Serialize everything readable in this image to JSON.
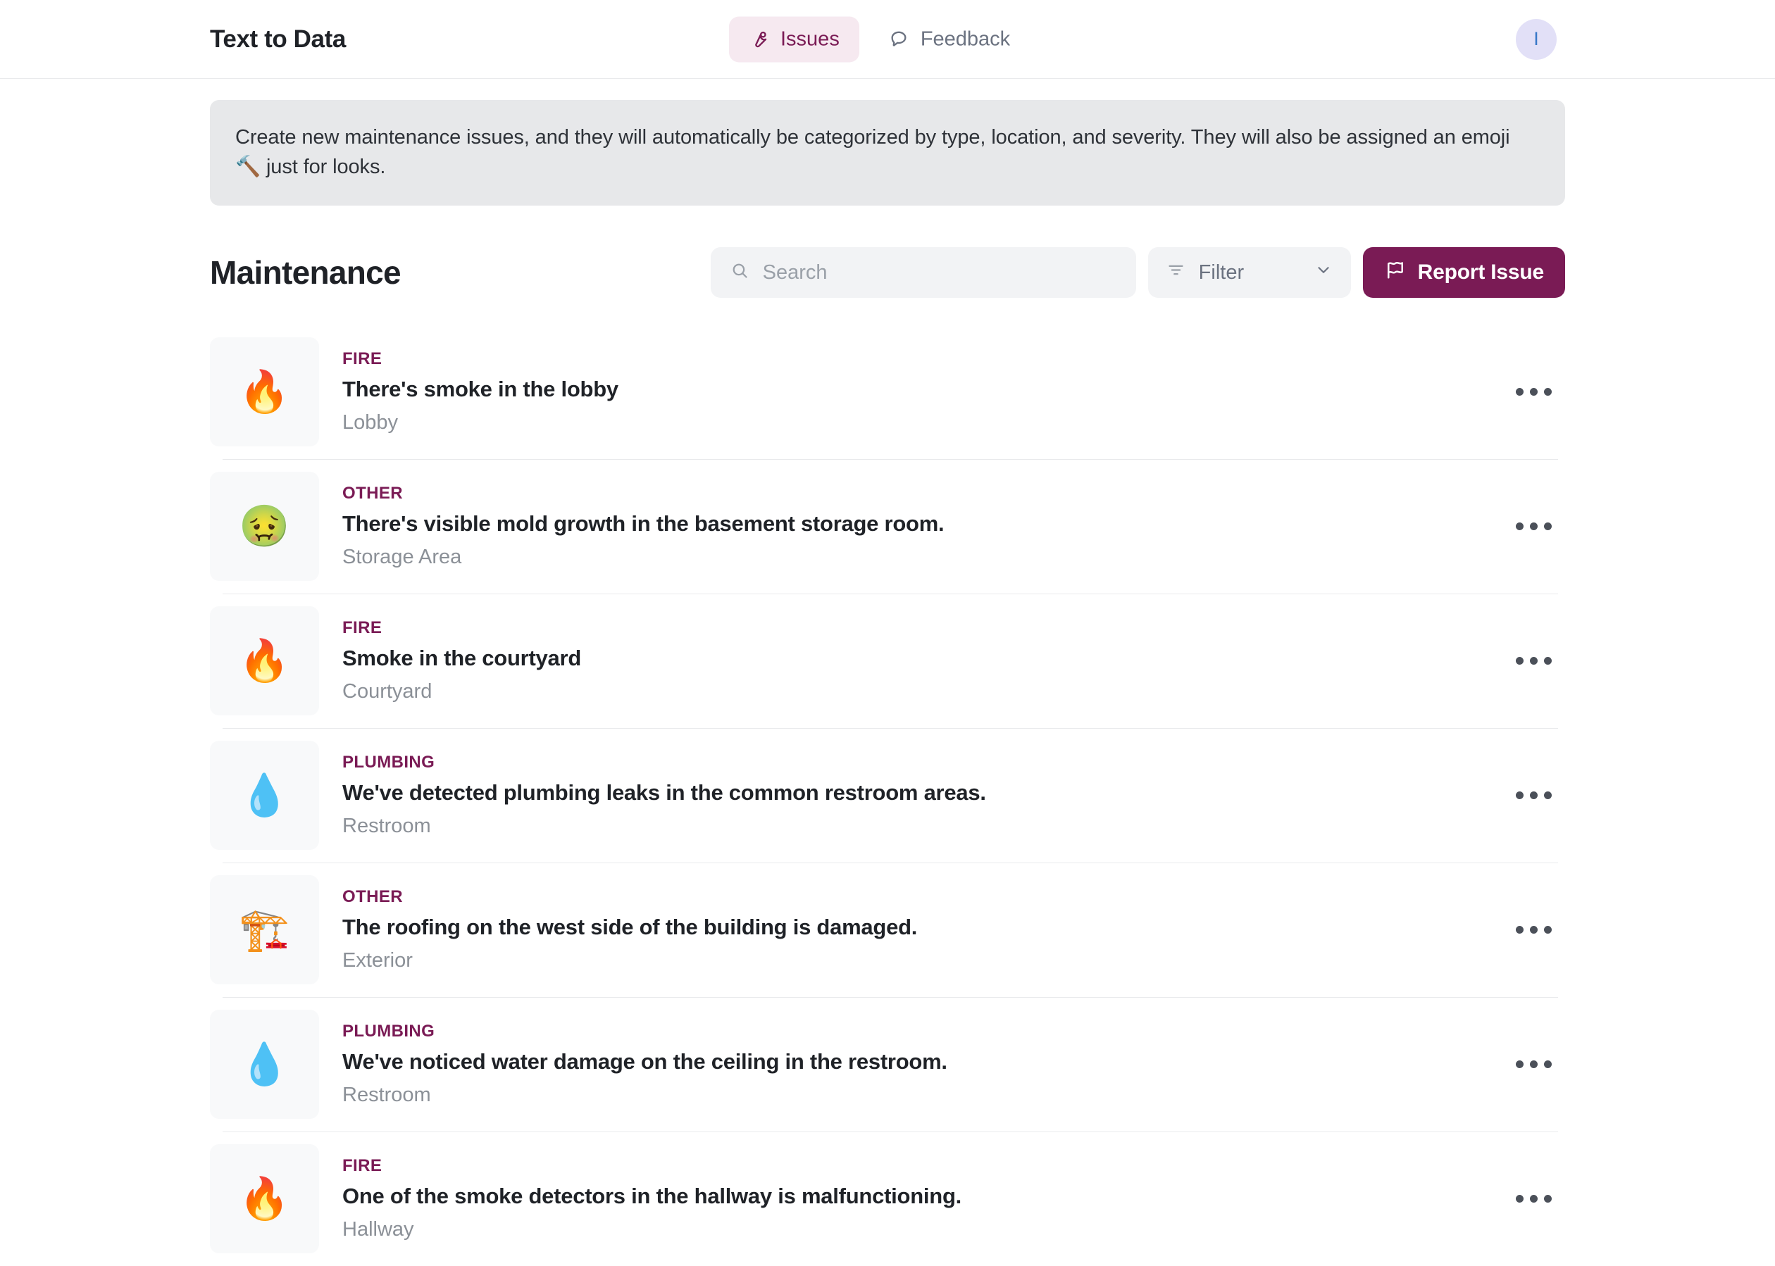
{
  "header": {
    "brand": "Text to Data",
    "tabs": [
      {
        "label": "Issues",
        "icon": "wrench-icon",
        "active": true
      },
      {
        "label": "Feedback",
        "icon": "speech-bubble-icon",
        "active": false
      }
    ],
    "avatar_initial": "I"
  },
  "banner": {
    "text": "Create new maintenance issues, and they will automatically be categorized by type, location, and severity. They will also be assigned an emoji 🔨 just for looks."
  },
  "toolbar": {
    "title": "Maintenance",
    "search_placeholder": "Search",
    "search_value": "",
    "search_icon": "search-icon",
    "filter_label": "Filter",
    "filter_icon": "filter-icon",
    "filter_chevron": "chevron-down-icon",
    "report_label": "Report Issue",
    "report_icon": "flag-icon"
  },
  "colors": {
    "accent": "#7a1b55",
    "accent_soft": "#f6e9f0",
    "muted_text": "#8b9097",
    "surface": "#f2f3f5",
    "banner_bg": "#e7e8ea",
    "tile_bg": "#f8f9fa",
    "avatar_bg": "#e2e0f7",
    "avatar_text": "#3878c8"
  },
  "issues": [
    {
      "emoji": "🔥",
      "category": "FIRE",
      "title": "There's smoke in the lobby",
      "location": "Lobby"
    },
    {
      "emoji": "🤢",
      "category": "OTHER",
      "title": "There's visible mold growth in the basement storage room.",
      "location": "Storage Area"
    },
    {
      "emoji": "🔥",
      "category": "FIRE",
      "title": "Smoke in the courtyard",
      "location": "Courtyard"
    },
    {
      "emoji": "💧",
      "category": "PLUMBING",
      "title": "We've detected plumbing leaks in the common restroom areas.",
      "location": "Restroom"
    },
    {
      "emoji": "🏗️",
      "category": "OTHER",
      "title": "The roofing on the west side of the building is damaged.",
      "location": "Exterior"
    },
    {
      "emoji": "💧",
      "category": "PLUMBING",
      "title": "We've noticed water damage on the ceiling in the restroom.",
      "location": "Restroom"
    },
    {
      "emoji": "🔥",
      "category": "FIRE",
      "title": "One of the smoke detectors in the hallway is malfunctioning.",
      "location": "Hallway"
    }
  ]
}
